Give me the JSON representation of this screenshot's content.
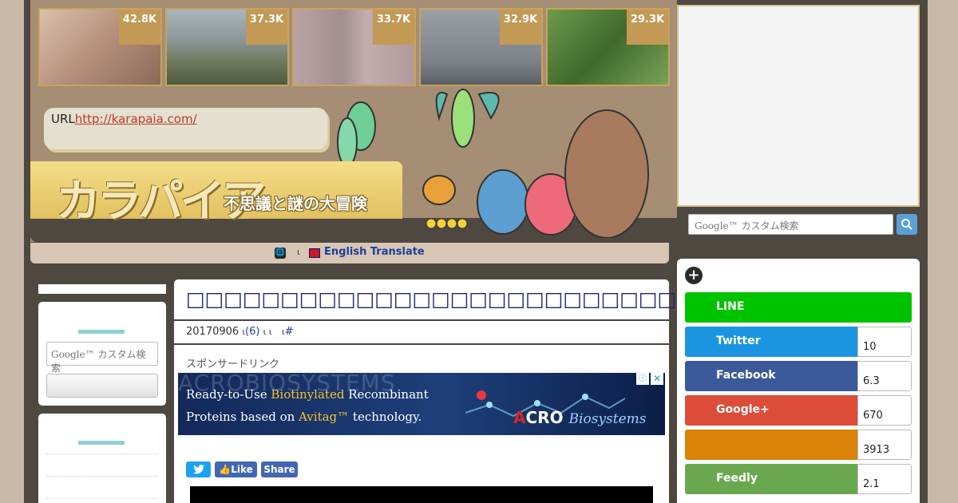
{
  "thumbnails": [
    {
      "count": "42.8K",
      "bg": "#c7a88f"
    },
    {
      "count": "37.3K",
      "bg": "#7c8a8c"
    },
    {
      "count": "33.7K",
      "bg": "#b49a9c"
    },
    {
      "count": "32.9K",
      "bg": "#8d8f95"
    },
    {
      "count": "29.3K",
      "bg": "#4f7a38"
    }
  ],
  "header": {
    "url_label": "URL",
    "url_link": "http://karapaia.com/",
    "logo_text": "カラパイア",
    "logo_subtitle": "不思議と謎の大冒険"
  },
  "translate": {
    "globe": "🌐",
    "separator": "ι",
    "link_label": "English Translate"
  },
  "right_search": {
    "placeholder": "Google™ カスタム検索",
    "button_icon": "search-icon"
  },
  "left_sidebar": {
    "search_placeholder": "Google™ カスタム検索"
  },
  "article": {
    "title": "□□□□□□□□□□□□□□□□□□□□□□□□□□□□□□□",
    "date": "20170906",
    "meta_sep1": "ι",
    "comments": "(6)",
    "meta_sep2": "ι ι",
    "meta_sep3": "ι",
    "hash": "#",
    "sponsor_label": "スポンサードリンク"
  },
  "ad": {
    "bg_word": "ACROBIOSYSTEMS",
    "line1_pre": "Ready-to-Use ",
    "line1_hl": "Biotinylated",
    "line1_post": " Recombinant",
    "line2_pre": "Proteins based on ",
    "line2_hl": "Avitag™",
    "line2_post": " technology.",
    "brand_a": "A",
    "brand_cro": "CRO",
    "brand_bs": "Biosystems",
    "info_icon": "ⓘ",
    "close_icon": "✕"
  },
  "share": {
    "twitter_icon": "twitter-icon",
    "like_label": "Like",
    "share_label": "Share"
  },
  "social": [
    {
      "name": "LINE",
      "count": "",
      "color": "#00c300"
    },
    {
      "name": "Twitter",
      "count": "10",
      "color": "#1b95e0"
    },
    {
      "name": "Facebook",
      "count": "6.3",
      "color": "#3b5998"
    },
    {
      "name": "Google+",
      "count": "670",
      "color": "#dd4b39"
    },
    {
      "name": "",
      "count": "3913",
      "color": "#d98309"
    },
    {
      "name": "Feedly",
      "count": "2.1",
      "color": "#6cc655"
    }
  ]
}
